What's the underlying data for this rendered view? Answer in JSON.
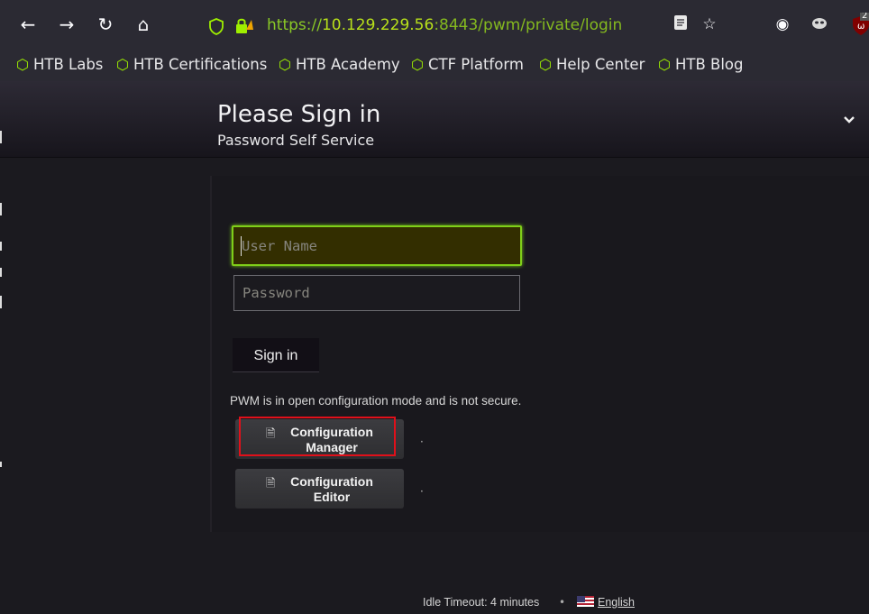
{
  "browser": {
    "url": {
      "scheme": "https://",
      "host": "10.129.229.56",
      "rest": ":8443/pwm/private/login"
    },
    "nav_icons": [
      "back-icon",
      "forward-icon",
      "reload-icon",
      "home-icon"
    ],
    "extension_badge": "2"
  },
  "bookmarks": [
    "HTB Labs",
    "HTB Certifications",
    "HTB Academy",
    "CTF Platform",
    "Help Center",
    "HTB Blog"
  ],
  "header": {
    "title": "Please Sign in",
    "subtitle": "Password Self Service"
  },
  "login": {
    "username_placeholder": "User Name",
    "password_placeholder": "Password",
    "signin_label": "Sign in",
    "warning": "PWM is in open configuration mode and is not secure."
  },
  "config": {
    "manager_line1": "Configuration",
    "manager_line2": "Manager",
    "editor_line1": "Configuration",
    "editor_line2": "Editor"
  },
  "footer": {
    "idle": "Idle Timeout: 4 minutes",
    "separator": "•",
    "language": "English"
  },
  "colors": {
    "accent": "#9fef00",
    "highlight": "#e0101a"
  }
}
